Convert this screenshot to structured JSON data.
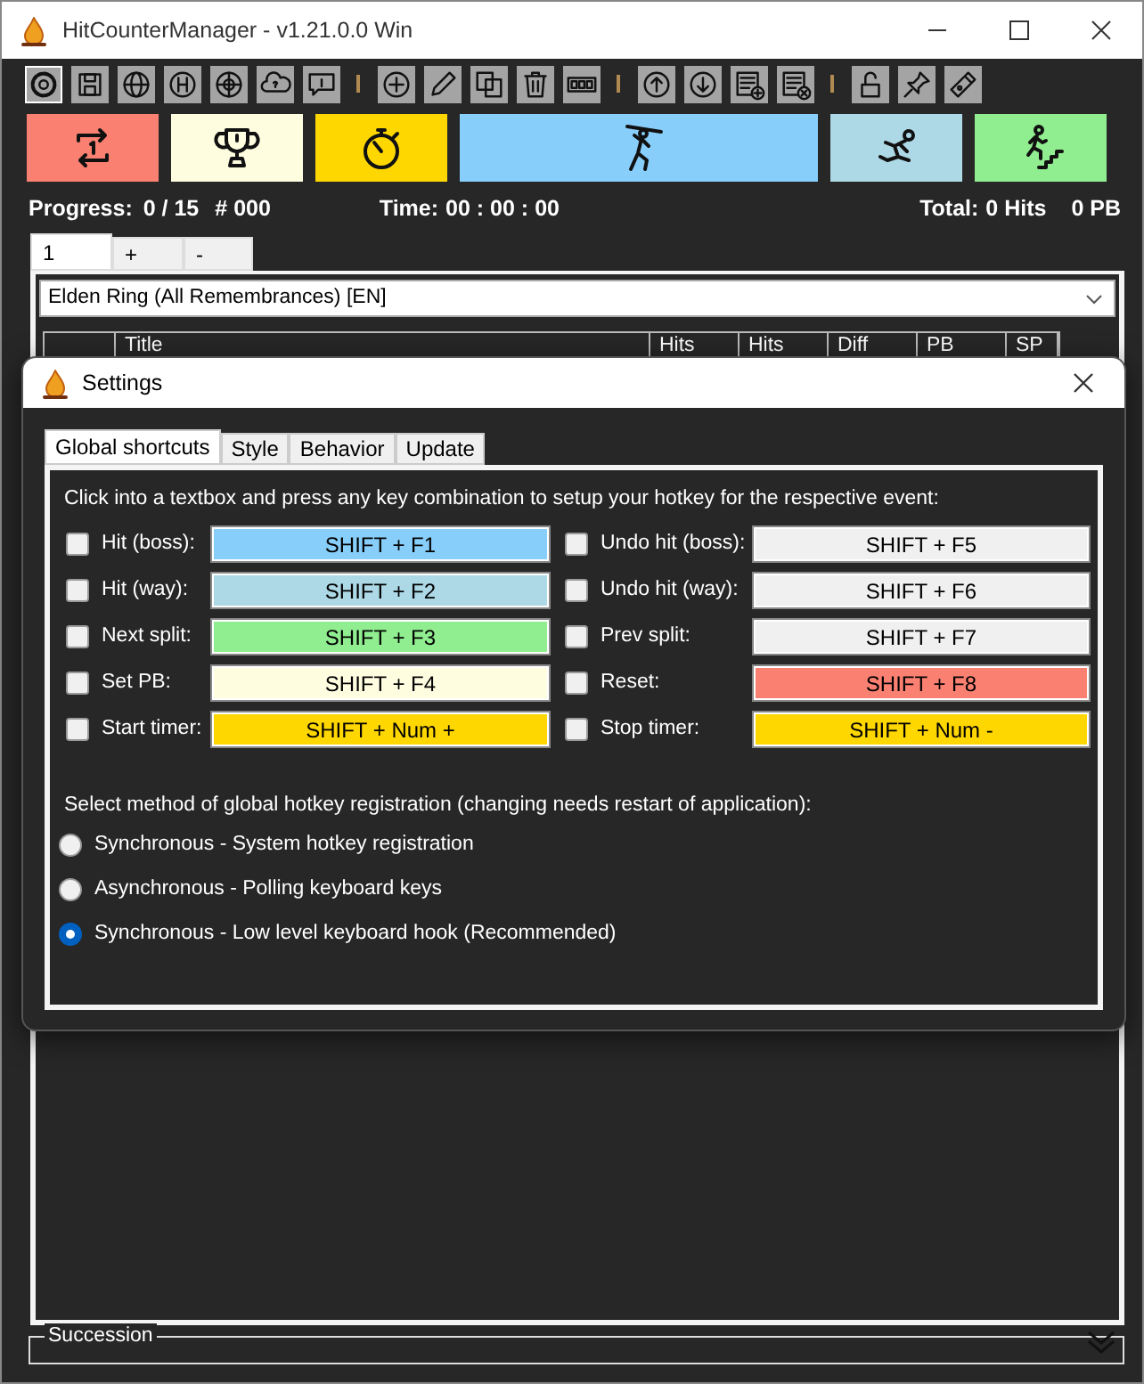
{
  "window": {
    "title": "HitCounterManager - v1.21.0.0 Win"
  },
  "action_buttons": [
    {
      "kind": "reset",
      "color": "#fa8072"
    },
    {
      "kind": "pb",
      "color": "#fffde0"
    },
    {
      "kind": "timer",
      "color": "#ffd700"
    },
    {
      "kind": "hit_boss",
      "color": "#87cefa"
    },
    {
      "kind": "hit_way",
      "color": "#add8e6"
    },
    {
      "kind": "split",
      "color": "#90ee90"
    }
  ],
  "status": {
    "progress_label": "Progress:",
    "progress": "0 / 15",
    "attempt": "# 000",
    "time_label": "Time:",
    "time": "00 : 00 : 00",
    "total_label": "Total:",
    "hits": "0 Hits",
    "pb": "0 PB"
  },
  "profile_tabs": [
    {
      "label": "1",
      "selected": true
    },
    {
      "label": "+",
      "selected": false
    },
    {
      "label": "-",
      "selected": false
    }
  ],
  "profile_select": {
    "value": "Elden Ring (All Remembrances) [EN]"
  },
  "table": {
    "columns": [
      "Title",
      "Hits",
      "Hits",
      "Diff",
      "PB",
      "SP"
    ]
  },
  "succession": {
    "title": "Succession"
  },
  "settings_dialog": {
    "title": "Settings",
    "tabs": [
      {
        "label": "Global shortcuts",
        "selected": true
      },
      {
        "label": "Style",
        "selected": false
      },
      {
        "label": "Behavior",
        "selected": false
      },
      {
        "label": "Update",
        "selected": false
      }
    ],
    "instruction": "Click into a textbox and press any key combination to setup your hotkey for the respective event:",
    "shortcuts": [
      {
        "label": "Hit (boss):",
        "checked": false,
        "value": "SHIFT + F1",
        "color": "#87cefa"
      },
      {
        "label": "Undo hit (boss):",
        "checked": false,
        "value": "SHIFT + F5",
        "color": "#f0f0f0"
      },
      {
        "label": "Hit (way):",
        "checked": false,
        "value": "SHIFT + F2",
        "color": "#add8e6"
      },
      {
        "label": "Undo hit (way):",
        "checked": false,
        "value": "SHIFT + F6",
        "color": "#f0f0f0"
      },
      {
        "label": "Next split:",
        "checked": false,
        "value": "SHIFT + F3",
        "color": "#90ee90"
      },
      {
        "label": "Prev split:",
        "checked": false,
        "value": "SHIFT + F7",
        "color": "#f0f0f0"
      },
      {
        "label": "Set PB:",
        "checked": false,
        "value": "SHIFT + F4",
        "color": "#fffde0"
      },
      {
        "label": "Reset:",
        "checked": false,
        "value": "SHIFT + F8",
        "color": "#fa8072"
      },
      {
        "label": "Start timer:",
        "checked": false,
        "value": "SHIFT + Num +",
        "color": "#ffd700"
      },
      {
        "label": "Stop timer:",
        "checked": false,
        "value": "SHIFT + Num -",
        "color": "#ffd700"
      }
    ],
    "method_prompt": "Select method of global hotkey registration (changing needs restart of application):",
    "methods": [
      {
        "label": "Synchronous - System hotkey registration",
        "selected": false
      },
      {
        "label": "Asynchronous - Polling keyboard keys",
        "selected": false
      },
      {
        "label": "Synchronous - Low level keyboard hook (Recommended)",
        "selected": true
      }
    ]
  }
}
